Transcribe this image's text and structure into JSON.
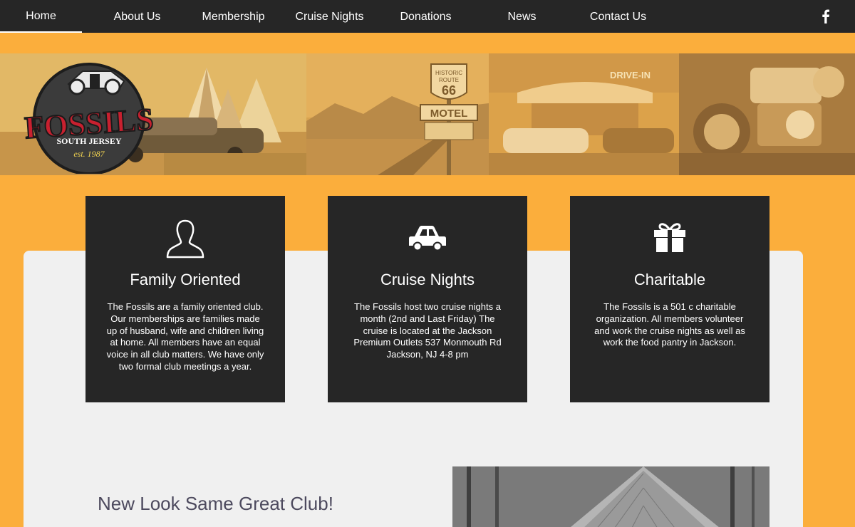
{
  "nav": {
    "items": [
      {
        "label": "Home",
        "active": true
      },
      {
        "label": "About Us"
      },
      {
        "label": "Membership"
      },
      {
        "label": "Cruise Nights"
      },
      {
        "label": "Donations"
      },
      {
        "label": "News"
      },
      {
        "label": "Contact Us"
      }
    ],
    "social_icon": "facebook-icon"
  },
  "hero": {
    "logo": {
      "name": "FOSSILS",
      "region": "SOUTH JERSEY",
      "established": "est. 1987"
    },
    "motel_sign": {
      "top": "HISTORIC",
      "route": "ROUTE",
      "number": "66",
      "name": "MOTEL"
    },
    "drive_in_sign": "DRIVE-IN"
  },
  "cards": [
    {
      "icon": "person-icon",
      "title": "Family Oriented",
      "text": "The Fossils are a family oriented club. Our memberships are families made up of husband, wife and children living at home. All members have an equal voice in all club matters. We have only two formal club meetings a year."
    },
    {
      "icon": "car-icon",
      "title": "Cruise Nights",
      "text": "The Fossils host two cruise nights a month (2nd and Last Friday) The cruise is located at the Jackson Premium Outlets 537 Monmouth Rd Jackson, NJ 4-8 pm"
    },
    {
      "icon": "gift-icon",
      "title": "Charitable",
      "text": "The Fossils is a 501 c charitable organization. All members volunteer and work the cruise nights as well as work the food pantry in Jackson."
    }
  ],
  "section": {
    "title": "New Look Same Great Club!"
  },
  "colors": {
    "page_bg": "#fbae3c",
    "nav_bg": "#262626",
    "card_bg": "#262626",
    "content_bg": "#f0f0f0",
    "logo_red": "#c8202f",
    "section_title": "#4d4a5e"
  }
}
